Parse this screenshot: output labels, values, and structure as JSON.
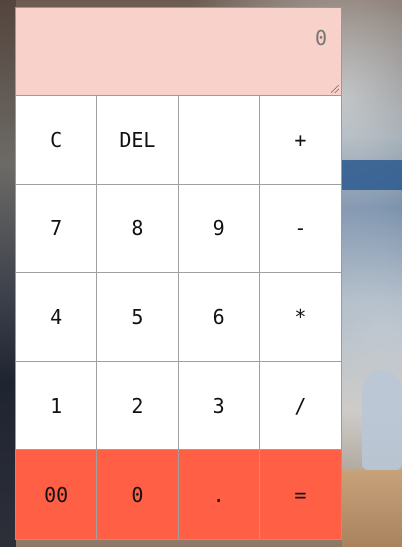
{
  "display": {
    "placeholder": "0",
    "value": ""
  },
  "keys": {
    "row1": [
      "C",
      "DEL",
      "",
      "+"
    ],
    "row2": [
      "7",
      "8",
      "9",
      "-"
    ],
    "row3": [
      "4",
      "5",
      "6",
      "*"
    ],
    "row4": [
      "1",
      "2",
      "3",
      "/"
    ],
    "row5": [
      "00",
      "0",
      ".",
      "="
    ]
  },
  "colors": {
    "display_background": "#f9d1cb",
    "key_background": "#ffffff",
    "accent_row_background": "#fe5f45",
    "grid_line": "#a0a0a0"
  }
}
